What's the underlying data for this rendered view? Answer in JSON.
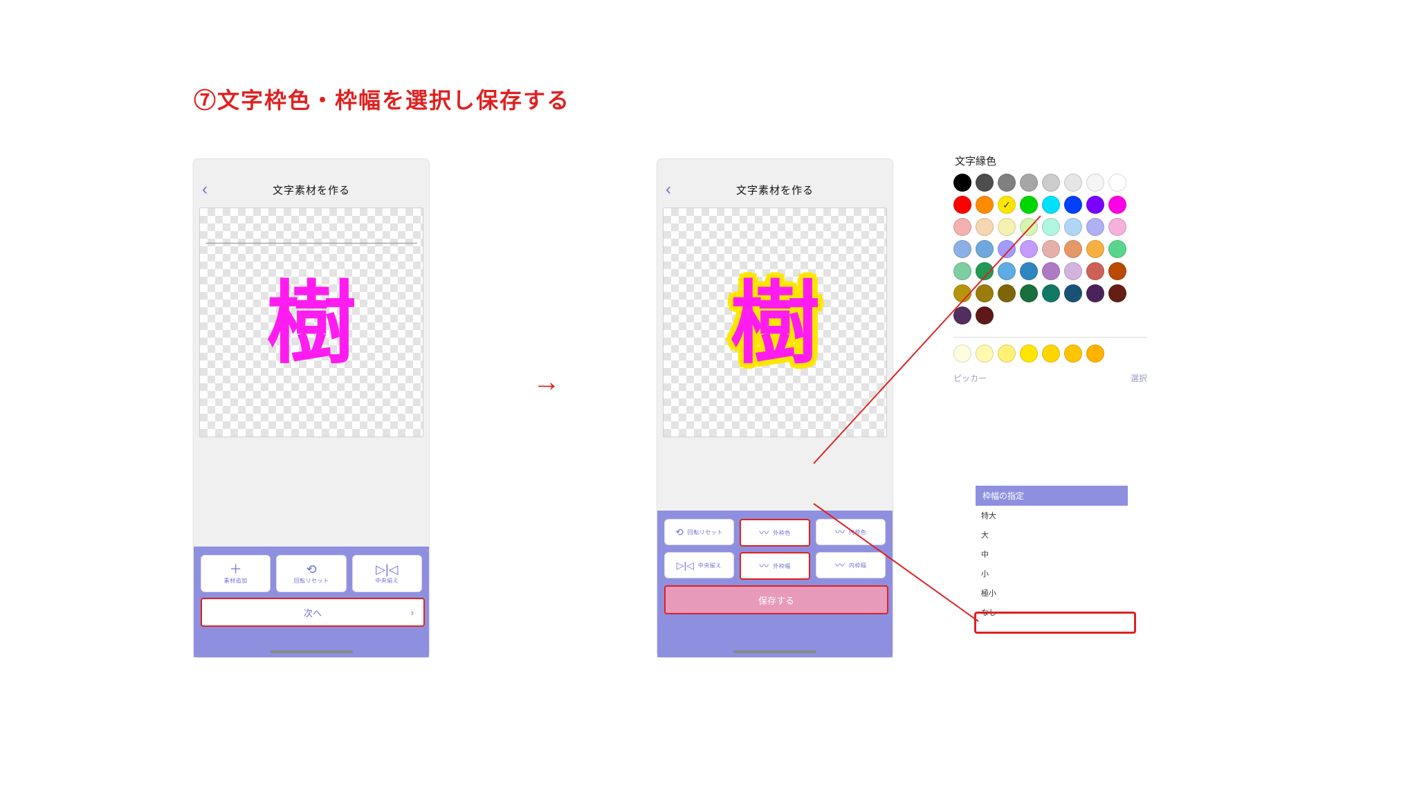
{
  "step_title": "⑦文字枠色・枠幅を選択し保存する",
  "nav": {
    "back_glyph": "‹",
    "title": "文字素材を作る"
  },
  "canvas": {
    "character": "樹"
  },
  "left_toolbar": {
    "btn1": {
      "icon": "＋",
      "label": "素材追加"
    },
    "btn2": {
      "icon": "⟲",
      "label": "回転リセット"
    },
    "btn3": {
      "icon": "▷|◁",
      "label": "中央揃え"
    },
    "next": {
      "label": "次へ",
      "chev": "›"
    }
  },
  "right_toolbar": {
    "row1": {
      "a": {
        "icon": "⟲",
        "label": "回転リセット"
      },
      "b": {
        "icon": "〰",
        "label": "外枠色"
      },
      "c": {
        "icon": "〰",
        "label": "内枠色"
      }
    },
    "row2": {
      "a": {
        "icon": "▷|◁",
        "label": "中央揃え"
      },
      "b": {
        "icon": "〰",
        "label": "外枠幅"
      },
      "c": {
        "icon": "〰",
        "label": "内枠幅"
      }
    },
    "save": {
      "label": "保存する"
    }
  },
  "picker": {
    "title": "文字縁色",
    "footer_left": "ピッカー",
    "footer_right": "選択",
    "selected_hex": "#ffe600",
    "palette": [
      "#000000",
      "#4d4d4d",
      "#808080",
      "#a6a6a6",
      "#cccccc",
      "#e6e6e6",
      "#f5f5f5",
      "#ffffff",
      "#ff0000",
      "#ff8c00",
      "#ffe600",
      "#00d600",
      "#00e0ff",
      "#0040ff",
      "#7a00ff",
      "#ff00e6",
      "#f5b0b0",
      "#f5d6b0",
      "#f5f1b0",
      "#d6f5b0",
      "#b0f5e0",
      "#b0d6f5",
      "#b0b0f5",
      "#f5b0dc",
      "#8cb0e6",
      "#6fa8dc",
      "#a29bfe",
      "#c49bfe",
      "#e6b0aa",
      "#e59866",
      "#f5b041",
      "#58d68d",
      "#7dcea0",
      "#229954",
      "#5dade2",
      "#2e86c1",
      "#af7ac5",
      "#d2b4de",
      "#cd6155",
      "#ba4a00",
      "#b7950b",
      "#9a7d0a",
      "#7d6608",
      "#196f3d",
      "#117864",
      "#1a5276",
      "#4a235a",
      "#641e16",
      "#512e5e",
      "#5d1919"
    ],
    "recent": [
      "#fffde0",
      "#fff9b0",
      "#fff176",
      "#ffe600",
      "#ffd600",
      "#ffc400",
      "#ffb300"
    ]
  },
  "width_panel": {
    "header": "枠幅の指定",
    "options": [
      "特大",
      "大",
      "中",
      "小",
      "極小",
      "なし"
    ],
    "highlighted": "極小"
  },
  "arrow_glyph": "→"
}
